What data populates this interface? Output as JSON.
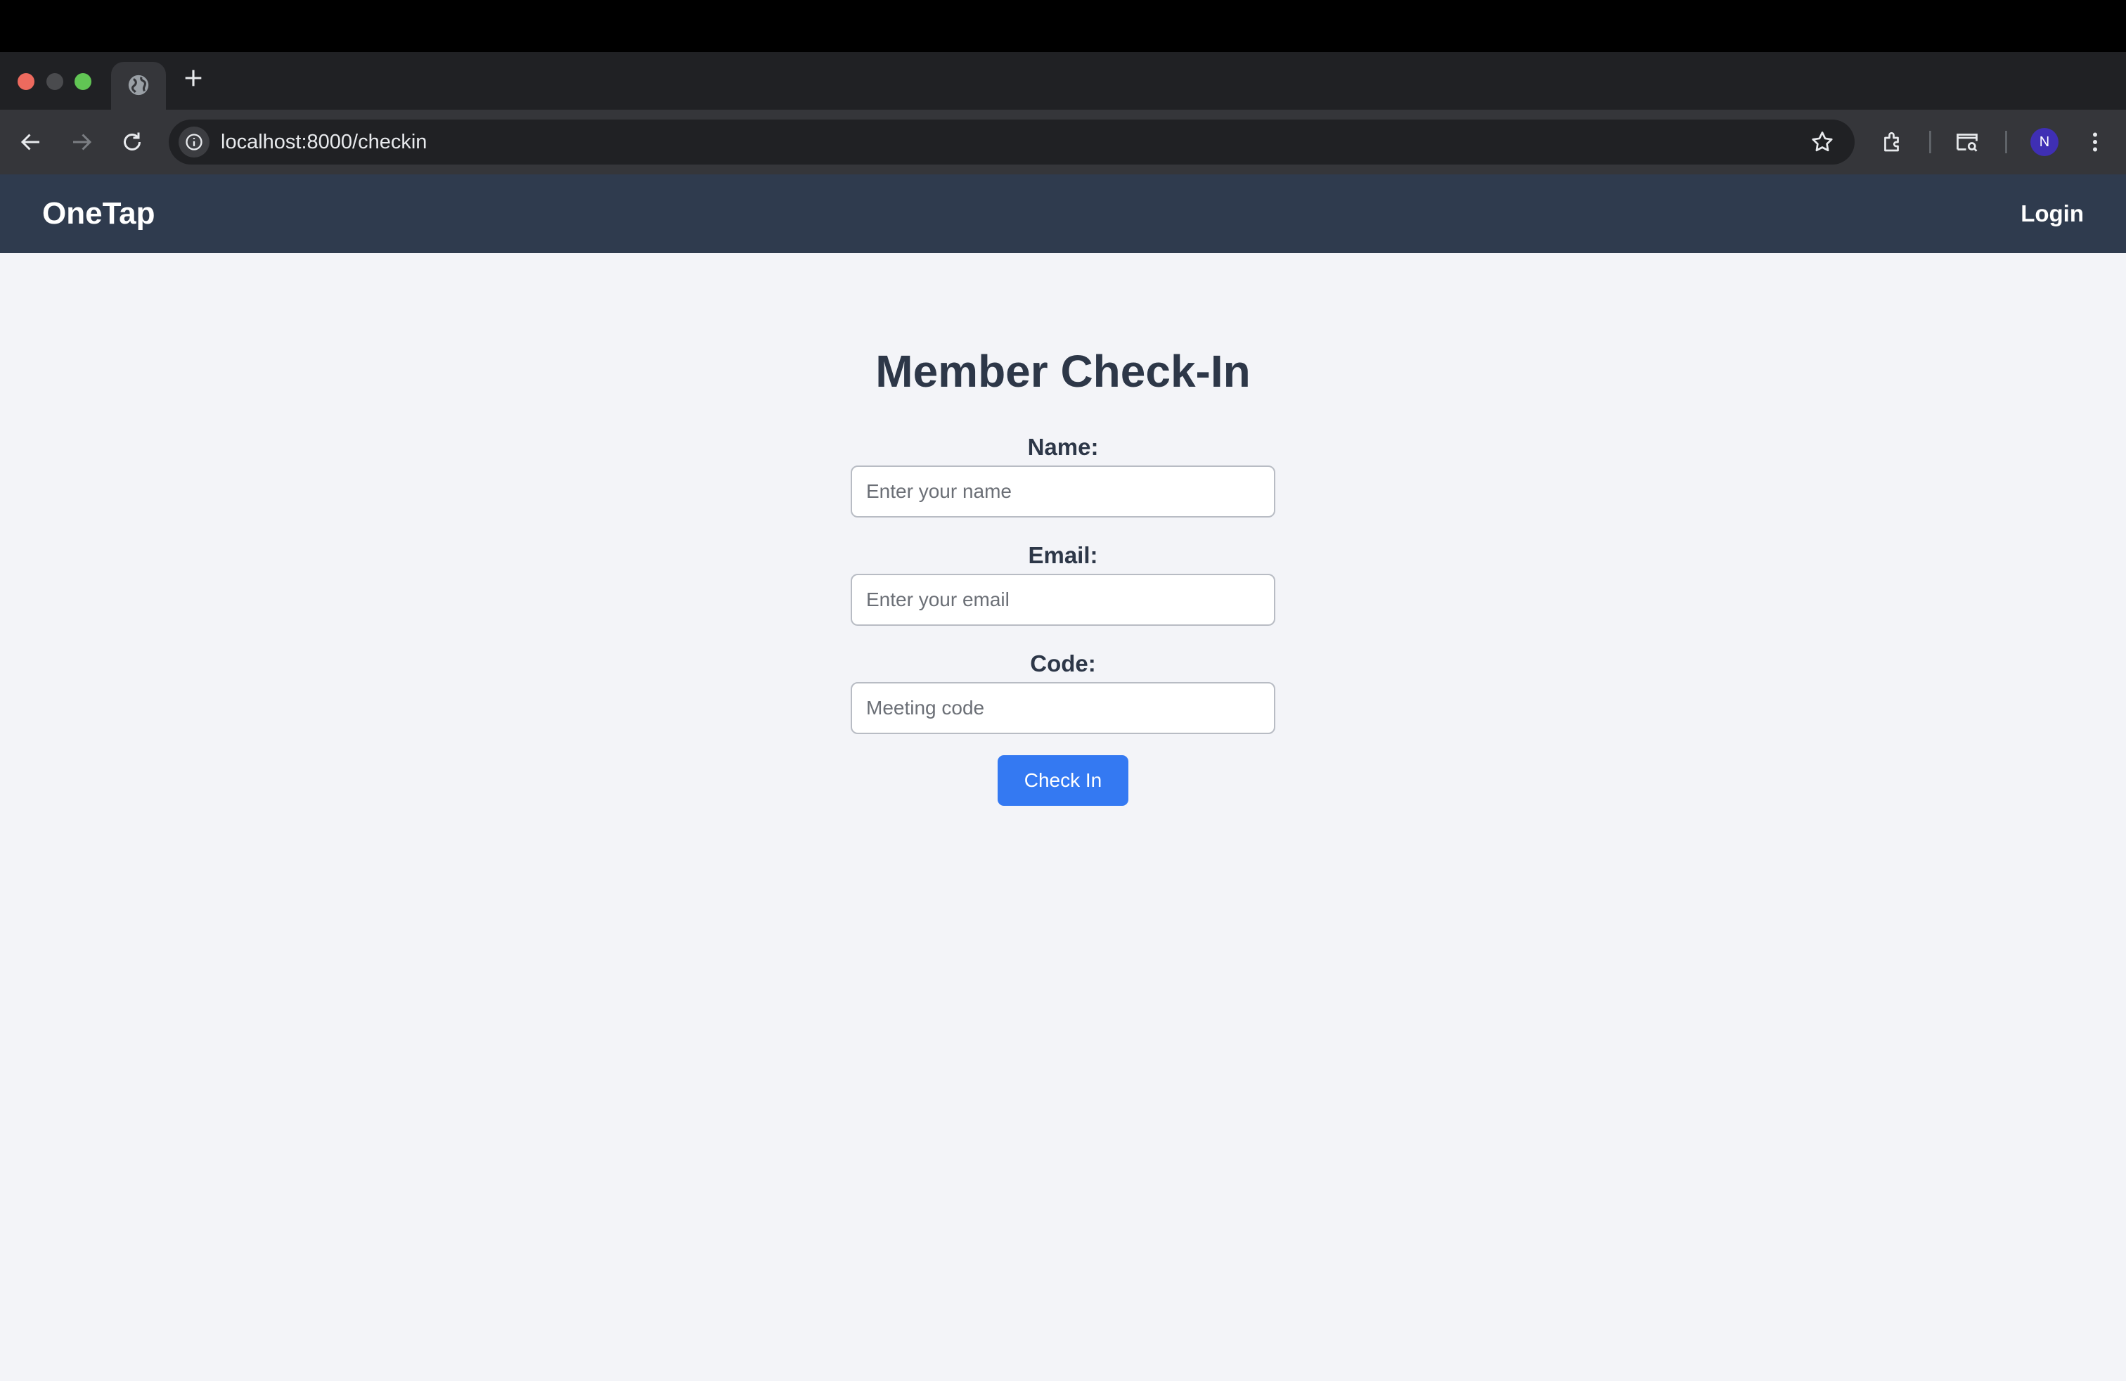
{
  "browser": {
    "url": "localhost:8000/checkin",
    "profile_initial": "N"
  },
  "header": {
    "brand": "OneTap",
    "login_label": "Login"
  },
  "form": {
    "title": "Member Check-In",
    "name_label": "Name:",
    "name_placeholder": "Enter your name",
    "email_label": "Email:",
    "email_placeholder": "Enter your email",
    "code_label": "Code:",
    "code_placeholder": "Meeting code",
    "submit_label": "Check In"
  },
  "colors": {
    "header_bg": "#2f3b4e",
    "page_bg": "#f3f4f8",
    "button_bg": "#3479f2",
    "text": "#2d3748"
  },
  "icons": [
    "globe-icon",
    "plus-icon",
    "back-arrow-icon",
    "forward-arrow-icon",
    "reload-icon",
    "info-icon",
    "star-icon",
    "extensions-icon",
    "tab-search-icon",
    "more-icon"
  ]
}
